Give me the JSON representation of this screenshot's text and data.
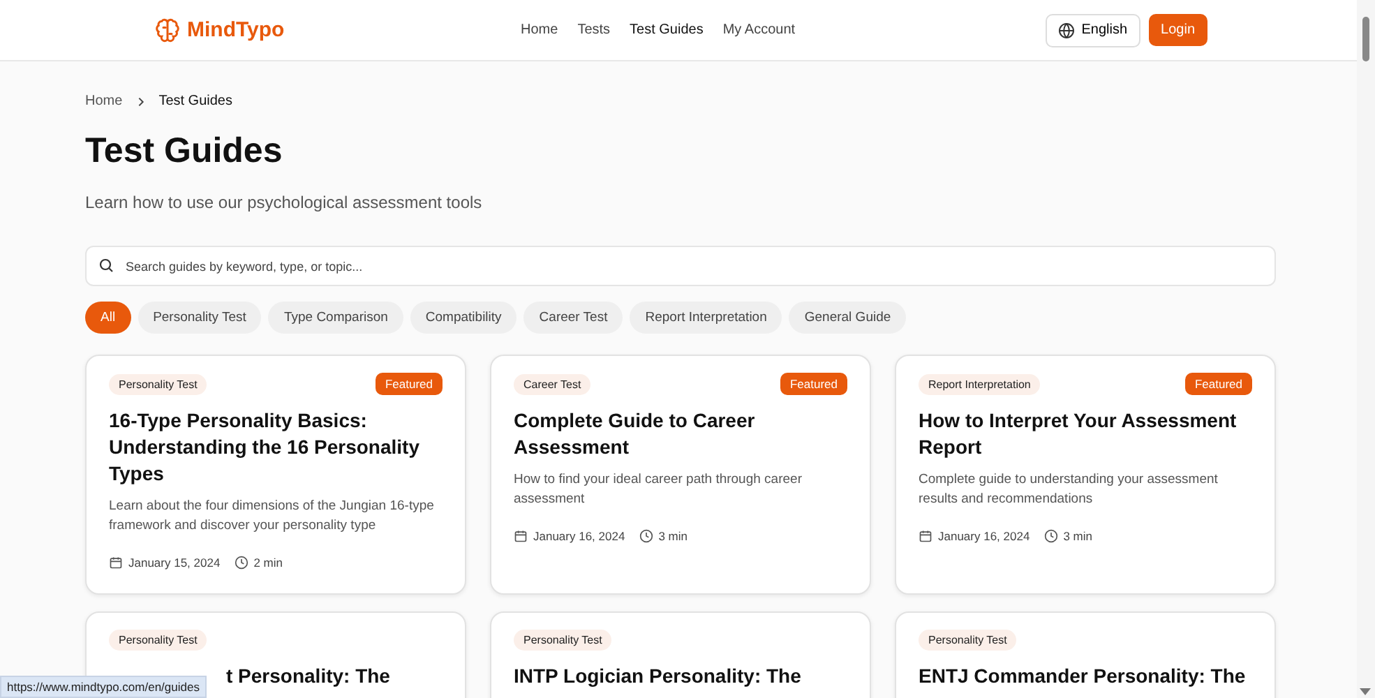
{
  "header": {
    "logo": "MindTypo",
    "nav": [
      {
        "label": "Home",
        "selected": false
      },
      {
        "label": "Tests",
        "selected": false
      },
      {
        "label": "Test Guides",
        "selected": true
      },
      {
        "label": "My Account",
        "selected": false
      }
    ],
    "language": "English",
    "login": "Login"
  },
  "breadcrumb": [
    "Home",
    "Test Guides"
  ],
  "title": "Test Guides",
  "subtitle": "Learn how to use our psychological assessment tools",
  "search": {
    "placeholder": "Search guides by keyword, type, or topic..."
  },
  "filters": [
    {
      "label": "All",
      "selected": true
    },
    {
      "label": "Personality Test",
      "selected": false
    },
    {
      "label": "Type Comparison",
      "selected": false
    },
    {
      "label": "Compatibility",
      "selected": false
    },
    {
      "label": "Career Test",
      "selected": false
    },
    {
      "label": "Report Interpretation",
      "selected": false
    },
    {
      "label": "General Guide",
      "selected": false
    }
  ],
  "guides": [
    {
      "category": "Personality Test",
      "badge": "Featured",
      "title": "16-Type Personality Basics: Understanding the 16 Personality Types",
      "description": "Learn about the four dimensions of the Jungian 16-type framework and discover your personality type",
      "date": "January 15, 2024",
      "read_time": "2 min"
    },
    {
      "category": "Career Test",
      "badge": "Featured",
      "title": "Complete Guide to Career Assessment",
      "description": "How to find your ideal career path through career assessment",
      "date": "January 16, 2024",
      "read_time": "3 min"
    },
    {
      "category": "Report Interpretation",
      "badge": "Featured",
      "title": "How to Interpret Your Assessment Report",
      "description": "Complete guide to understanding your assessment results and recommendations",
      "date": "January 16, 2024",
      "read_time": "3 min"
    },
    {
      "category": "Personality Test",
      "title": "t Personality: The",
      "partly_covered": true
    },
    {
      "category": "Personality Test",
      "title": "INTP Logician Personality: The"
    },
    {
      "category": "Personality Test",
      "title": "ENTJ Commander Personality: The"
    }
  ],
  "status_link": "https://www.mindtypo.com/en/guides"
}
